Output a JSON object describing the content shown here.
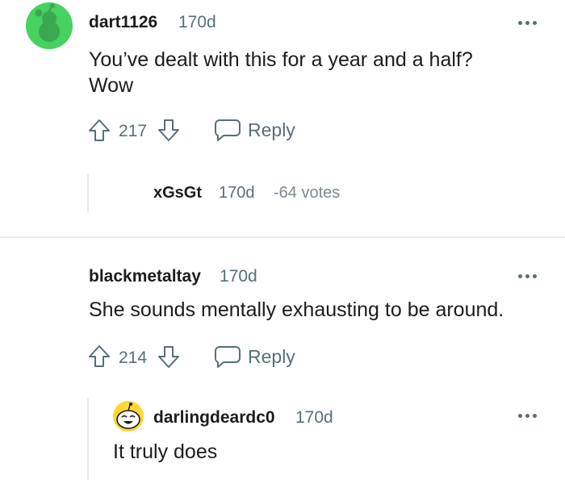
{
  "comments": [
    {
      "username": "dart1126",
      "age": "170d",
      "avatar_color": "#46d160",
      "text_line1": "You’ve dealt with this for a year and a half?",
      "text_line2": "Wow",
      "upvotes": "217",
      "reply_label": "Reply"
    },
    {
      "username": "xGsGt",
      "age": "170d",
      "votes_text": "-64 votes"
    },
    {
      "username": "blackmetaltay",
      "age": "170d",
      "text_line1": "She sounds mentally exhausting to be around.",
      "upvotes": "214",
      "reply_label": "Reply"
    },
    {
      "username": "darlingdeardc0",
      "age": "170d",
      "avatar_color": "#ffd635",
      "text_line1": "It truly does"
    }
  ],
  "colors": {
    "meta_text": "#576f76",
    "divider": "#e9ecee",
    "thread_line": "#e4e9eb"
  }
}
